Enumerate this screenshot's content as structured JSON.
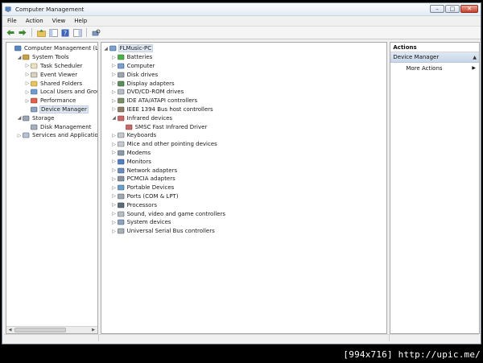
{
  "window": {
    "title": "Computer Management"
  },
  "menu": [
    {
      "label": "File"
    },
    {
      "label": "Action"
    },
    {
      "label": "View"
    },
    {
      "label": "Help"
    }
  ],
  "left_tree": [
    {
      "label": "Computer Management (Local",
      "indent": 0,
      "toggle": "",
      "icon": "computer-management-icon",
      "selected": false
    },
    {
      "label": "System Tools",
      "indent": 1,
      "toggle": "◢",
      "icon": "system-tools-icon",
      "selected": false
    },
    {
      "label": "Task Scheduler",
      "indent": 2,
      "toggle": "▷",
      "icon": "task-scheduler-icon",
      "selected": false
    },
    {
      "label": "Event Viewer",
      "indent": 2,
      "toggle": "▷",
      "icon": "event-viewer-icon",
      "selected": false
    },
    {
      "label": "Shared Folders",
      "indent": 2,
      "toggle": "▷",
      "icon": "shared-folders-icon",
      "selected": false
    },
    {
      "label": "Local Users and Groups",
      "indent": 2,
      "toggle": "▷",
      "icon": "users-icon",
      "selected": false
    },
    {
      "label": "Performance",
      "indent": 2,
      "toggle": "▷",
      "icon": "performance-icon",
      "selected": false
    },
    {
      "label": "Device Manager",
      "indent": 2,
      "toggle": "",
      "icon": "device-manager-icon",
      "selected": true
    },
    {
      "label": "Storage",
      "indent": 1,
      "toggle": "◢",
      "icon": "storage-icon",
      "selected": false
    },
    {
      "label": "Disk Management",
      "indent": 2,
      "toggle": "",
      "icon": "disk-management-icon",
      "selected": false
    },
    {
      "label": "Services and Applications",
      "indent": 1,
      "toggle": "▷",
      "icon": "services-icon",
      "selected": false
    }
  ],
  "device_tree": [
    {
      "label": "FLMusic-PC",
      "indent": 0,
      "toggle": "◢",
      "icon": "computer-icon",
      "selected": true
    },
    {
      "label": "Batteries",
      "indent": 1,
      "toggle": "▷",
      "icon": "battery-icon",
      "selected": false
    },
    {
      "label": "Computer",
      "indent": 1,
      "toggle": "▷",
      "icon": "computer-icon",
      "selected": false
    },
    {
      "label": "Disk drives",
      "indent": 1,
      "toggle": "▷",
      "icon": "disk-drive-icon",
      "selected": false
    },
    {
      "label": "Display adapters",
      "indent": 1,
      "toggle": "▷",
      "icon": "display-adapter-icon",
      "selected": false
    },
    {
      "label": "DVD/CD-ROM drives",
      "indent": 1,
      "toggle": "▷",
      "icon": "dvd-drive-icon",
      "selected": false
    },
    {
      "label": "IDE ATA/ATAPI controllers",
      "indent": 1,
      "toggle": "▷",
      "icon": "ide-controller-icon",
      "selected": false
    },
    {
      "label": "IEEE 1394 Bus host controllers",
      "indent": 1,
      "toggle": "▷",
      "icon": "ieee1394-icon",
      "selected": false
    },
    {
      "label": "Infrared devices",
      "indent": 1,
      "toggle": "◢",
      "icon": "infrared-icon",
      "selected": false
    },
    {
      "label": "SMSC Fast Infrared Driver",
      "indent": 2,
      "toggle": "",
      "icon": "infrared-icon",
      "selected": false
    },
    {
      "label": "Keyboards",
      "indent": 1,
      "toggle": "▷",
      "icon": "keyboard-icon",
      "selected": false
    },
    {
      "label": "Mice and other pointing devices",
      "indent": 1,
      "toggle": "▷",
      "icon": "mouse-icon",
      "selected": false
    },
    {
      "label": "Modems",
      "indent": 1,
      "toggle": "▷",
      "icon": "modem-icon",
      "selected": false
    },
    {
      "label": "Monitors",
      "indent": 1,
      "toggle": "▷",
      "icon": "monitor-icon",
      "selected": false
    },
    {
      "label": "Network adapters",
      "indent": 1,
      "toggle": "▷",
      "icon": "network-adapter-icon",
      "selected": false
    },
    {
      "label": "PCMCIA adapters",
      "indent": 1,
      "toggle": "▷",
      "icon": "pcmcia-icon",
      "selected": false
    },
    {
      "label": "Portable Devices",
      "indent": 1,
      "toggle": "▷",
      "icon": "portable-device-icon",
      "selected": false
    },
    {
      "label": "Ports (COM & LPT)",
      "indent": 1,
      "toggle": "▷",
      "icon": "port-icon",
      "selected": false
    },
    {
      "label": "Processors",
      "indent": 1,
      "toggle": "▷",
      "icon": "processor-icon",
      "selected": false
    },
    {
      "label": "Sound, video and game controllers",
      "indent": 1,
      "toggle": "▷",
      "icon": "sound-icon",
      "selected": false
    },
    {
      "label": "System devices",
      "indent": 1,
      "toggle": "▷",
      "icon": "system-device-icon",
      "selected": false
    },
    {
      "label": "Universal Serial Bus controllers",
      "indent": 1,
      "toggle": "▷",
      "icon": "usb-icon",
      "selected": false
    }
  ],
  "actions": {
    "title": "Actions",
    "section": "Device Manager",
    "item": "More Actions"
  },
  "watermark": "[994x716] http://upic.me/",
  "colors": {
    "window_border": "#6d7a8a",
    "selection": "#dde6f0",
    "actions_header": "#c8d6e8",
    "close_button": "#c8412c"
  }
}
